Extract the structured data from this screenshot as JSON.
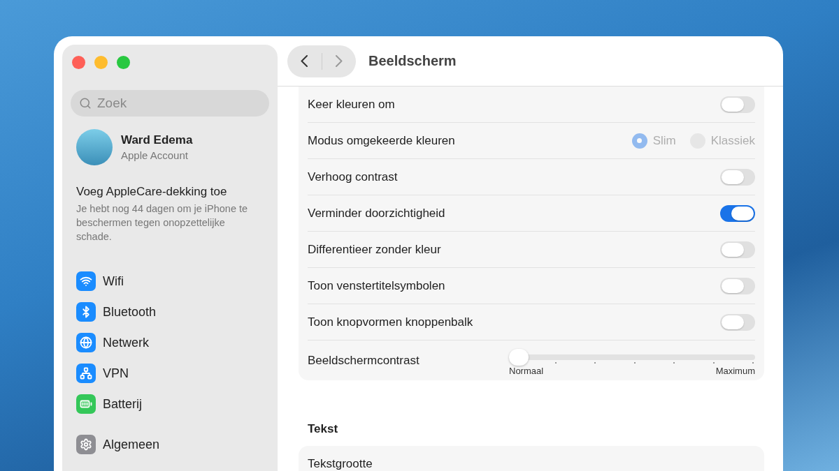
{
  "window": {
    "title": "Beeldscherm"
  },
  "sidebar": {
    "search": {
      "placeholder": "Zoek"
    },
    "account": {
      "name": "Ward Edema",
      "subtitle": "Apple Account"
    },
    "promo": {
      "title": "Voeg AppleCare-dekking toe",
      "text": "Je hebt nog 44 dagen om je iPhone te beschermen tegen onopzettelijke schade."
    },
    "groups": [
      [
        {
          "label": "Wifi",
          "color": "#1a8cff"
        },
        {
          "label": "Bluetooth",
          "color": "#1a8cff"
        },
        {
          "label": "Netwerk",
          "color": "#1a8cff"
        },
        {
          "label": "VPN",
          "color": "#1a8cff"
        },
        {
          "label": "Batterij",
          "color": "#34c759"
        }
      ],
      [
        {
          "label": "Algemeen",
          "color": "#8e8e93"
        }
      ]
    ]
  },
  "settings": [
    {
      "kind": "toggle",
      "label": "Keer kleuren om",
      "on": false
    },
    {
      "kind": "radio",
      "label": "Modus omgekeerde kleuren",
      "disabled": true,
      "options": [
        {
          "label": "Slim",
          "selected": true
        },
        {
          "label": "Klassiek",
          "selected": false
        }
      ]
    },
    {
      "kind": "toggle",
      "label": "Verhoog contrast",
      "on": false
    },
    {
      "kind": "toggle",
      "label": "Verminder doorzichtigheid",
      "on": true
    },
    {
      "kind": "toggle",
      "label": "Differentieer zonder kleur",
      "on": false
    },
    {
      "kind": "toggle",
      "label": "Toon venstertitelsymbolen",
      "on": false
    },
    {
      "kind": "toggle",
      "label": "Toon knopvormen knoppenbalk",
      "on": false
    },
    {
      "kind": "slider",
      "label": "Beeldschermcontrast",
      "level": 0,
      "min_label": "Normaal",
      "max_label": "Maximum"
    }
  ],
  "text_section": {
    "heading": "Tekst",
    "rows": [
      {
        "label": "Tekstgrootte"
      }
    ]
  }
}
